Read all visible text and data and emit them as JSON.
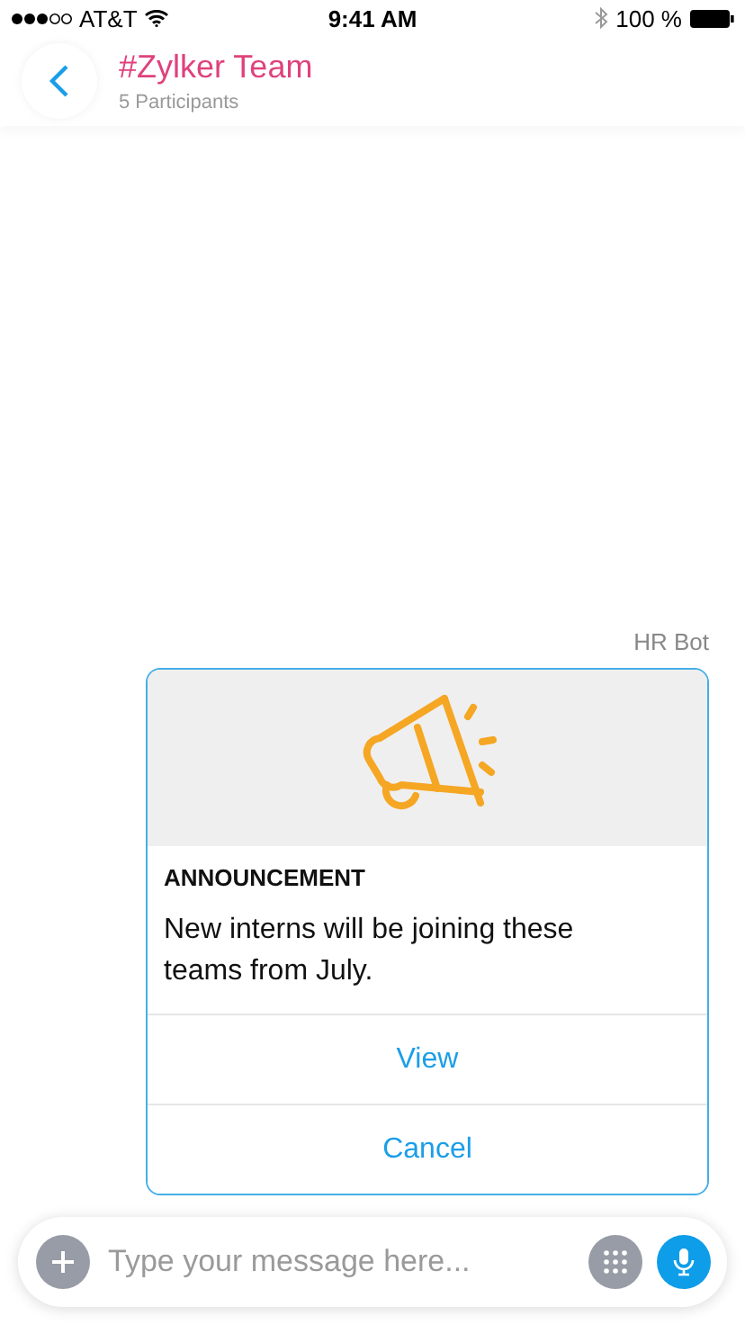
{
  "status_bar": {
    "carrier": "AT&T",
    "time": "9:41 AM",
    "battery": "100 %"
  },
  "header": {
    "title": "#Zylker Team",
    "subtitle": "5 Participants"
  },
  "message": {
    "sender": "HR Bot",
    "card": {
      "label": "ANNOUNCEMENT",
      "text": "New interns will be joining these teams from July.",
      "actions": [
        "View",
        "Cancel"
      ]
    }
  },
  "composer": {
    "placeholder": "Type your message here..."
  }
}
